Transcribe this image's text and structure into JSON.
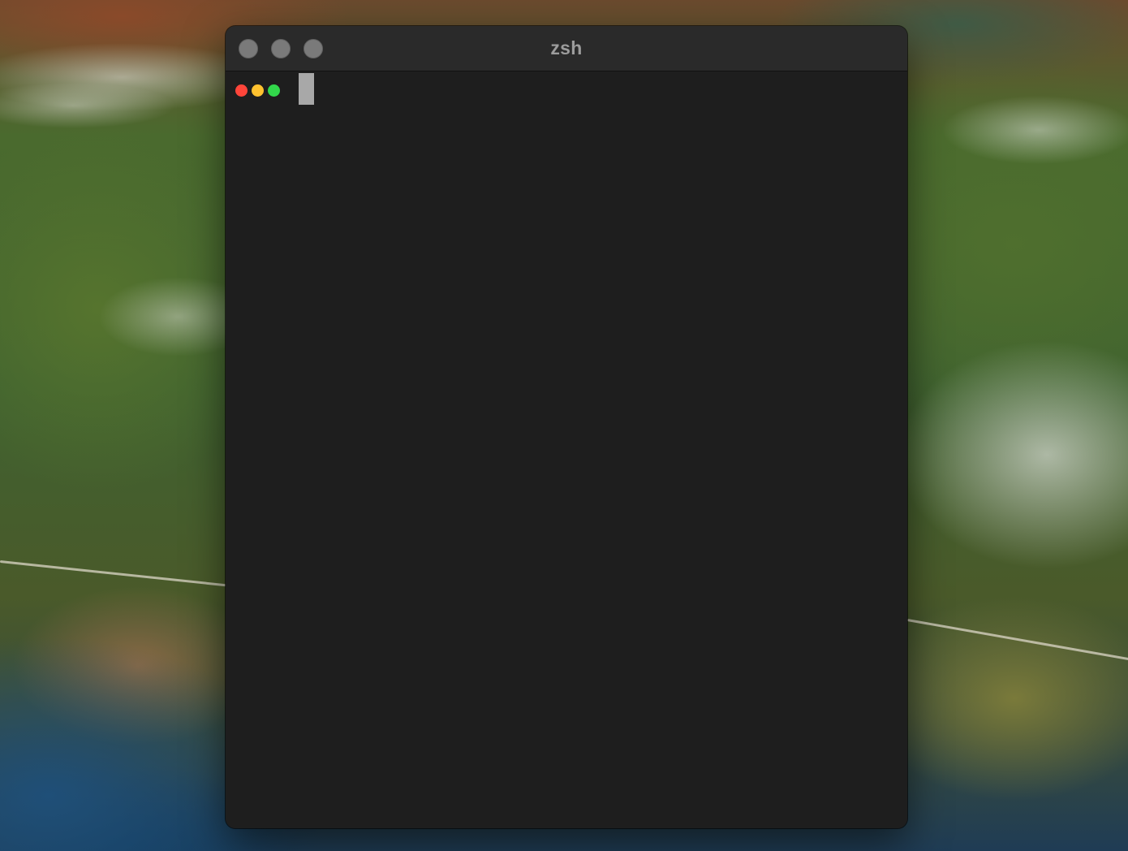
{
  "window": {
    "title": "zsh"
  },
  "titlebar_buttons": [
    {
      "name": "close",
      "color": "#7a7a7a"
    },
    {
      "name": "minimize",
      "color": "#7a7a7a"
    },
    {
      "name": "zoom",
      "color": "#7a7a7a"
    }
  ],
  "terminal": {
    "prompt_dot_colors": [
      "#ff453a",
      "#ffc22f",
      "#32d74b"
    ],
    "input_text": "",
    "cursor_color": "#a8a8a8"
  }
}
